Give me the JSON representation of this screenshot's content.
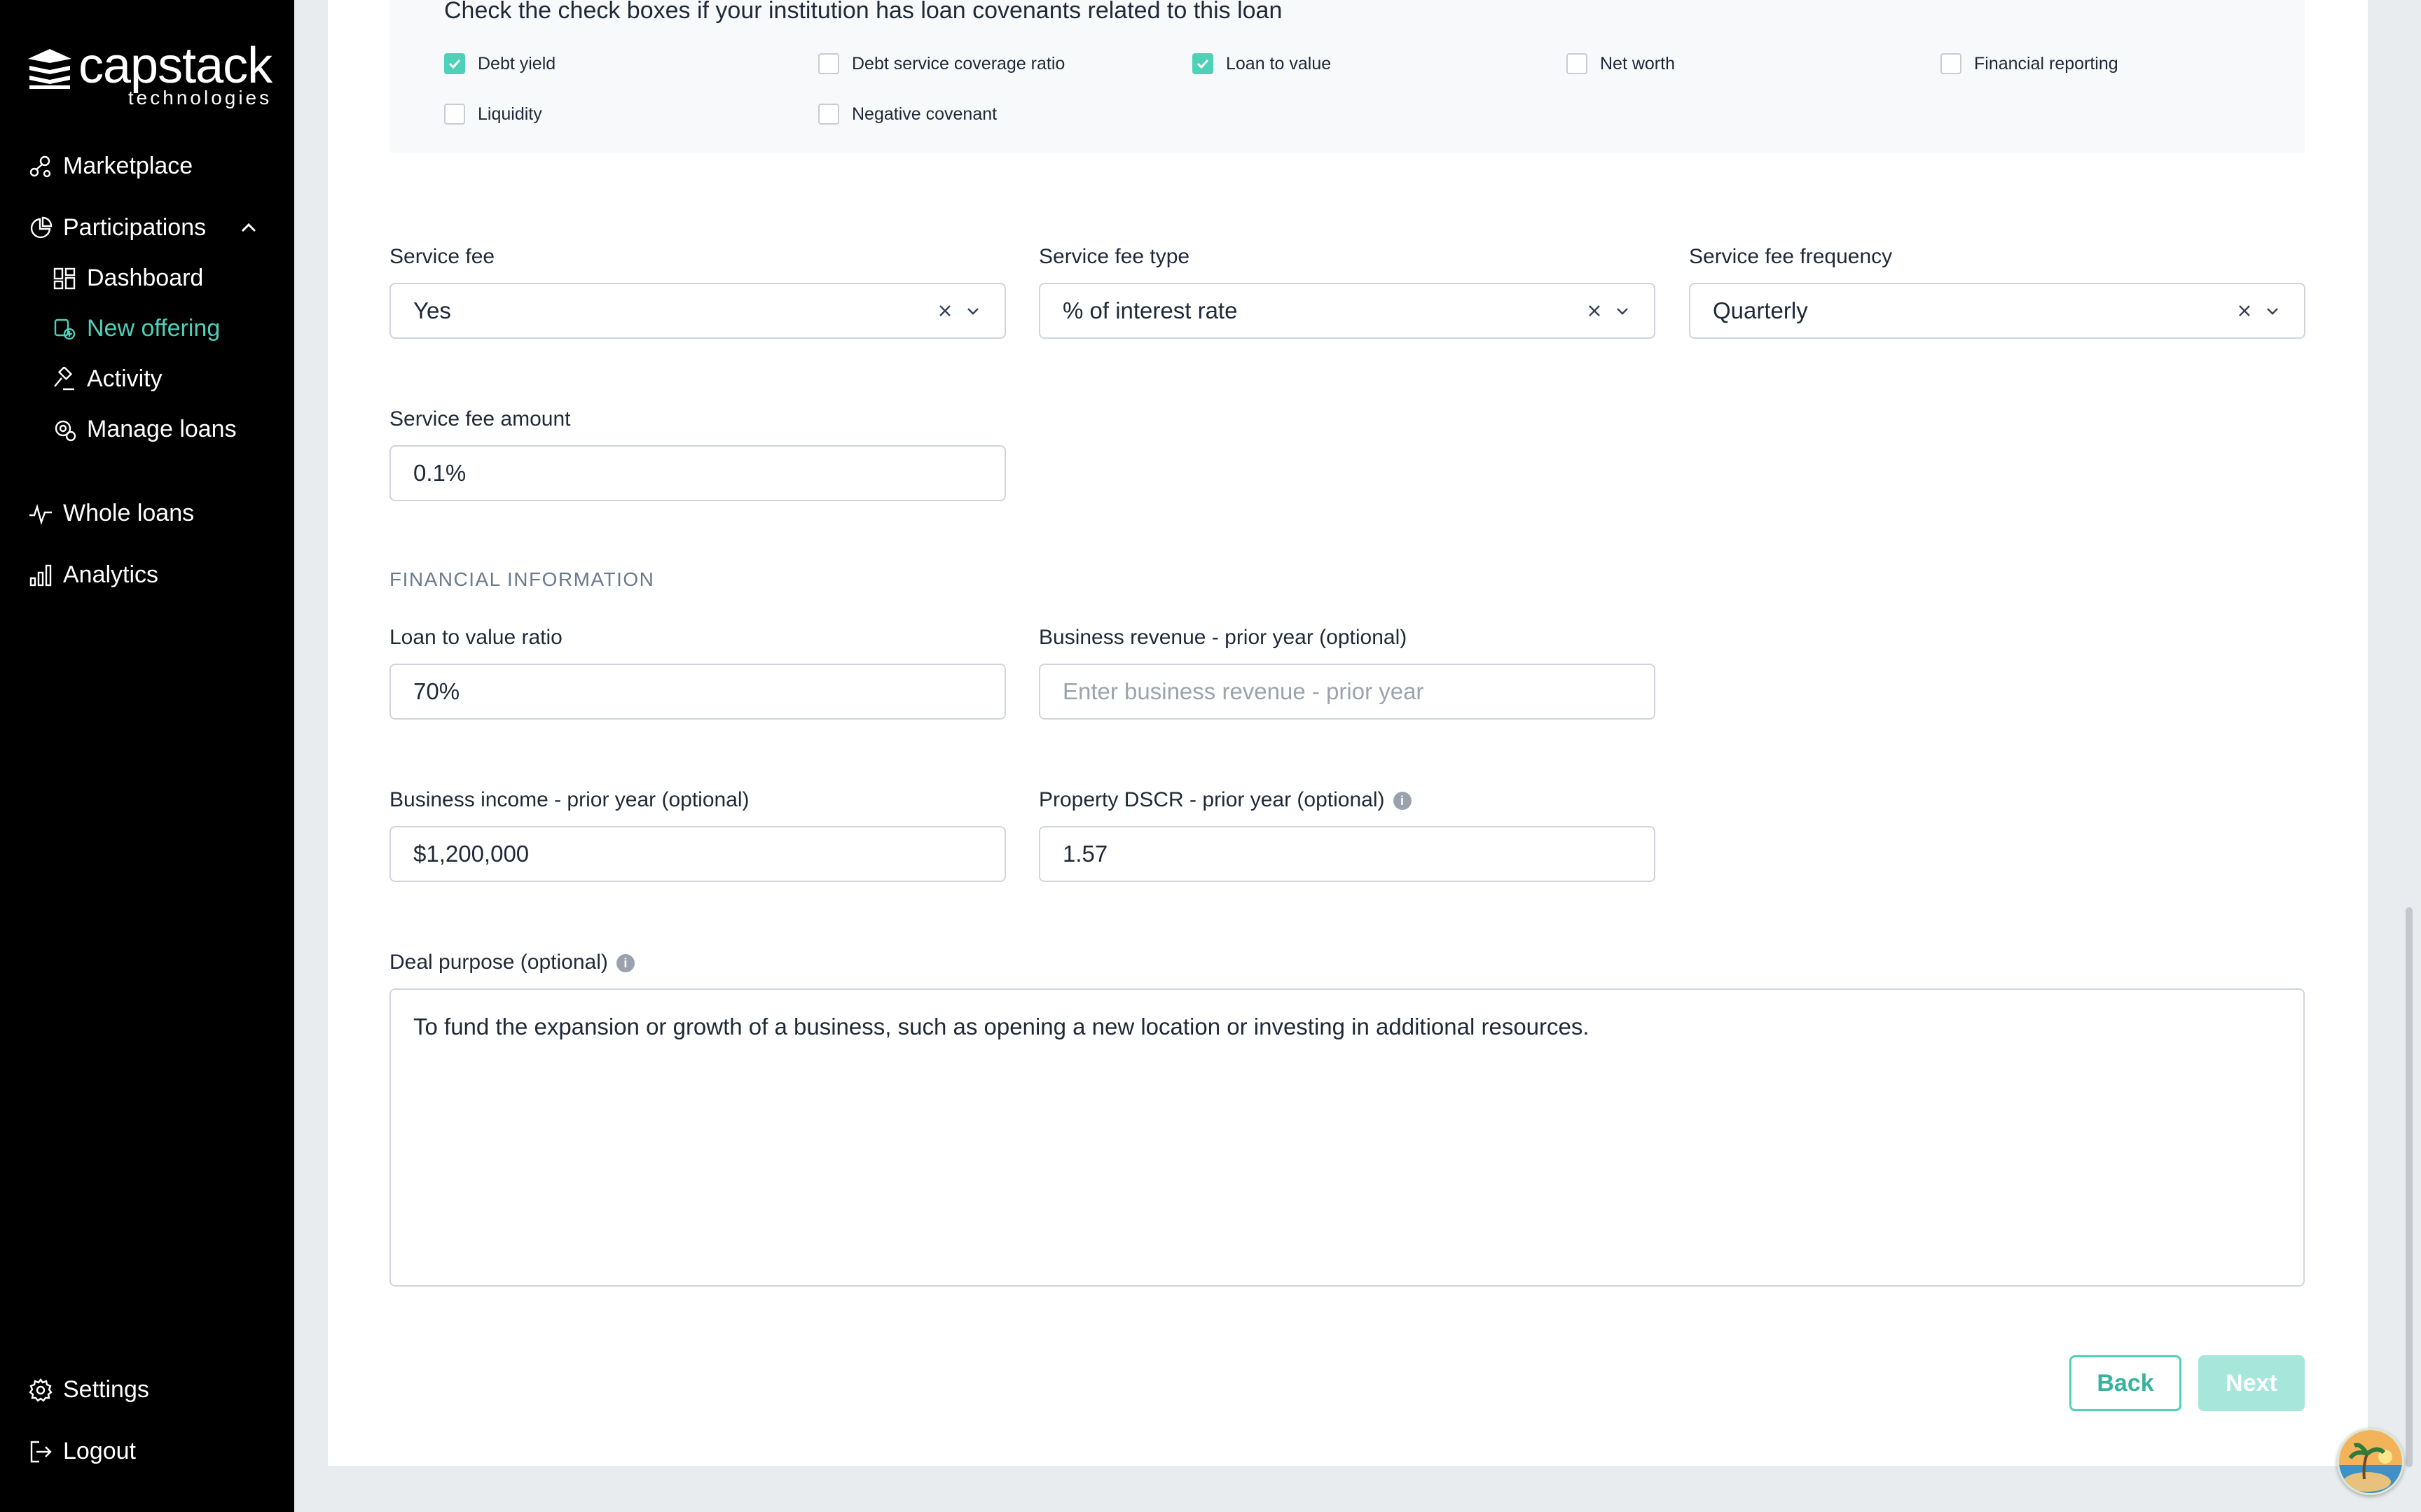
{
  "brand": {
    "name": "capstack",
    "sub": "technologies"
  },
  "sidebar": {
    "items": [
      {
        "label": "Marketplace",
        "icon": "marketplace-icon"
      },
      {
        "label": "Participations",
        "icon": "pie-chart-icon"
      },
      {
        "label": "Dashboard",
        "icon": "dashboard-icon"
      },
      {
        "label": "New offering",
        "icon": "new-offering-icon",
        "active": true
      },
      {
        "label": "Activity",
        "icon": "gavel-icon"
      },
      {
        "label": "Manage loans",
        "icon": "gear-money-icon"
      },
      {
        "label": "Whole loans",
        "icon": "pulse-icon"
      },
      {
        "label": "Analytics",
        "icon": "bar-chart-icon"
      }
    ],
    "settings_label": "Settings",
    "logout_label": "Logout"
  },
  "covenants": {
    "title": "Check the check boxes if your institution has loan covenants related to this loan",
    "options": [
      {
        "label": "Debt yield",
        "checked": true
      },
      {
        "label": "Debt service coverage ratio",
        "checked": false
      },
      {
        "label": "Loan to value",
        "checked": true
      },
      {
        "label": "Net worth",
        "checked": false
      },
      {
        "label": "Financial reporting",
        "checked": false
      },
      {
        "label": "Liquidity",
        "checked": false
      },
      {
        "label": "Negative covenant",
        "checked": false
      }
    ]
  },
  "service_fee": {
    "label": "Service fee",
    "value": "Yes",
    "type_label": "Service fee type",
    "type_value": "% of interest rate",
    "frequency_label": "Service fee frequency",
    "frequency_value": "Quarterly",
    "amount_label": "Service fee amount",
    "amount_value": "0.1%"
  },
  "financial": {
    "section_title": "FINANCIAL INFORMATION",
    "ltv_label": "Loan to value ratio",
    "ltv_value": "70%",
    "revenue_label": "Business revenue - prior year (optional)",
    "revenue_placeholder": "Enter business revenue - prior year",
    "income_label": "Business income - prior year (optional)",
    "income_value": "$1,200,000",
    "dscr_label": "Property DSCR - prior year (optional)",
    "dscr_value": "1.57"
  },
  "deal_purpose": {
    "label": "Deal purpose (optional)",
    "value": "To fund the expansion or growth of a business, such as opening a new location or investing in additional resources."
  },
  "buttons": {
    "back": "Back",
    "next": "Next"
  },
  "colors": {
    "accent": "#4fd1b9",
    "sidebar_bg": "#000000"
  }
}
